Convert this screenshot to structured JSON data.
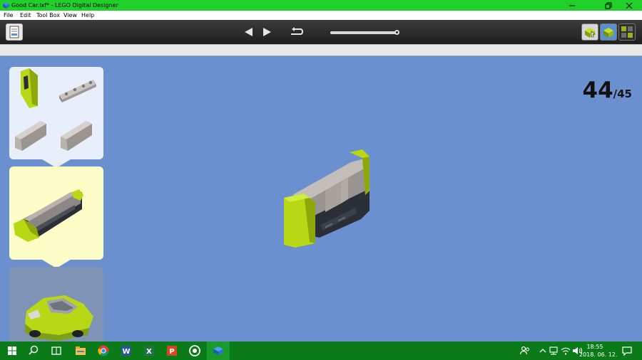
{
  "window": {
    "title": "Good Car.lxf* - LEGO Digital Designer",
    "app_icon": "lego-brick-icon",
    "controls": [
      "minimize-icon",
      "restore-icon",
      "close-icon"
    ]
  },
  "menu": {
    "items": [
      "File",
      "Edit",
      "Tool Box",
      "View",
      "Help"
    ]
  },
  "toolbar": {
    "doc_button_icon": "building-guide-document-icon",
    "nav": [
      "previous-step-icon",
      "next-step-icon"
    ],
    "rewind_icon": "rewind-icon",
    "step_slider_fraction": 0.978,
    "modes": [
      "build-mode-icon",
      "view-mode-icon",
      "building-guide-mode-icon"
    ]
  },
  "canvas": {
    "step_current": "44",
    "step_total": "/45"
  },
  "panels": {
    "parts_icon": "parts-list",
    "step_icon": "step-preview",
    "model_icon": "model-preview"
  },
  "colors": {
    "lime": "#b8d816",
    "lime_dark": "#8ea80c",
    "grey": "#b9b3b0",
    "grey_dark": "#8c8784",
    "black": "#2a2f37",
    "canvas_blue": "#6b90d0",
    "title_green": "#20cf2a",
    "taskbar_green": "#0b7a18"
  },
  "taskbar": {
    "icons": [
      "windows-start-icon",
      "search-icon",
      "task-view-icon",
      "file-explorer-icon",
      "chrome-icon",
      "word-icon",
      "excel-icon",
      "powerpoint-icon",
      "circle-app-icon",
      "lego-designer-icon"
    ],
    "tray": [
      "people-icon",
      "chevron-up-icon",
      "network-icon",
      "wifi-icon",
      "volume-icon"
    ],
    "time": "18:55",
    "date": "2018. 06. 12.",
    "notification_icon": "action-center-icon"
  }
}
